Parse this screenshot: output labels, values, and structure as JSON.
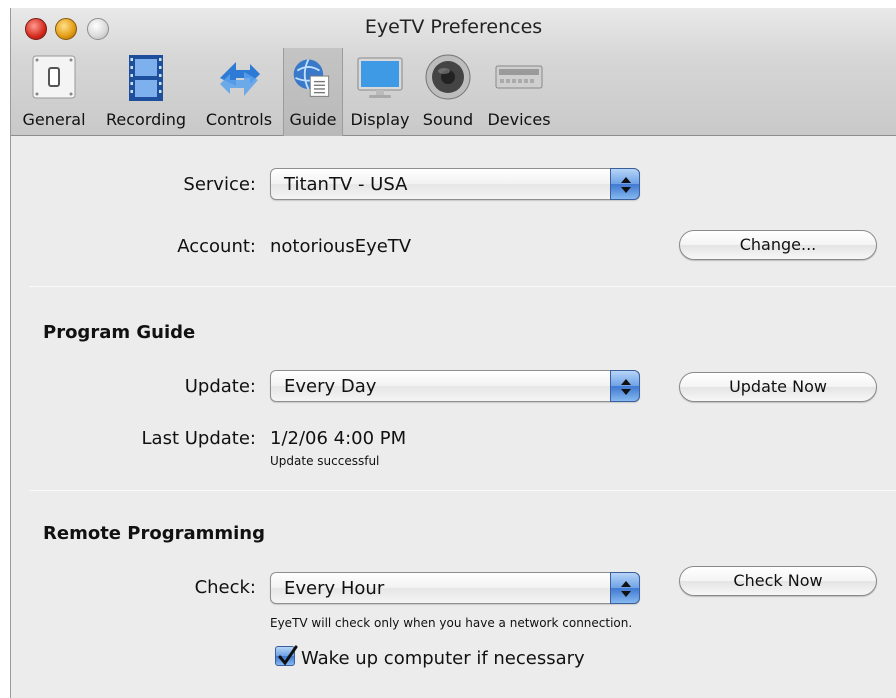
{
  "window": {
    "title": "EyeTV Preferences"
  },
  "toolbar": {
    "items": [
      {
        "label": "General",
        "icon": "switch-icon"
      },
      {
        "label": "Recording",
        "icon": "film-icon"
      },
      {
        "label": "Controls",
        "icon": "arrows-icon"
      },
      {
        "label": "Guide",
        "icon": "globe-document-icon",
        "selected": true
      },
      {
        "label": "Display",
        "icon": "monitor-icon"
      },
      {
        "label": "Sound",
        "icon": "speaker-icon"
      },
      {
        "label": "Devices",
        "icon": "device-icon"
      }
    ]
  },
  "service": {
    "label": "Service:",
    "value": "TitanTV - USA"
  },
  "account": {
    "label": "Account:",
    "value": "notoriousEyeTV",
    "change_button": "Change..."
  },
  "program_guide": {
    "heading": "Program Guide",
    "update_label": "Update:",
    "update_value": "Every Day",
    "update_now_button": "Update Now",
    "last_update_label": "Last Update:",
    "last_update_value": "1/2/06 4:00 PM",
    "status": "Update successful"
  },
  "remote_programming": {
    "heading": "Remote Programming",
    "check_label": "Check:",
    "check_value": "Every Hour",
    "check_now_button": "Check Now",
    "note": "EyeTV will check only when you have a network connection.",
    "wake_checkbox_label": "Wake up computer if necessary",
    "wake_checked": true
  },
  "colors": {
    "accent": "#4a86da",
    "window_bg": "#ececec"
  }
}
